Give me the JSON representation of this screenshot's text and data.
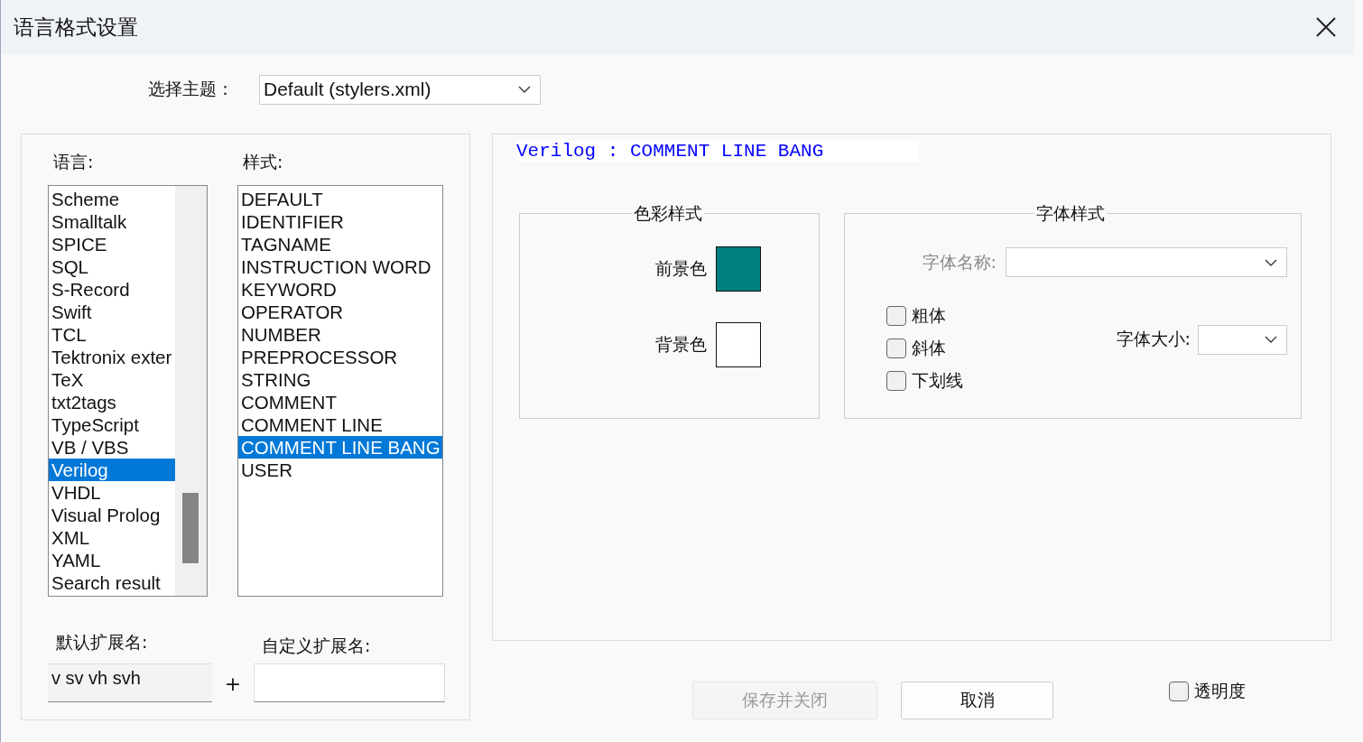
{
  "window": {
    "title": "语言格式设置"
  },
  "theme": {
    "label": "选择主题：",
    "value": "Default (stylers.xml)"
  },
  "languages": {
    "label": "语言:",
    "items": [
      {
        "label": "Scheme",
        "selected": false
      },
      {
        "label": "Smalltalk",
        "selected": false
      },
      {
        "label": "SPICE",
        "selected": false
      },
      {
        "label": "SQL",
        "selected": false
      },
      {
        "label": "S-Record",
        "selected": false
      },
      {
        "label": "Swift",
        "selected": false
      },
      {
        "label": "TCL",
        "selected": false
      },
      {
        "label": "Tektronix exter",
        "selected": false
      },
      {
        "label": "TeX",
        "selected": false
      },
      {
        "label": "txt2tags",
        "selected": false
      },
      {
        "label": "TypeScript",
        "selected": false
      },
      {
        "label": "VB / VBS",
        "selected": false
      },
      {
        "label": "Verilog",
        "selected": true
      },
      {
        "label": "VHDL",
        "selected": false
      },
      {
        "label": "Visual Prolog",
        "selected": false
      },
      {
        "label": "XML",
        "selected": false
      },
      {
        "label": "YAML",
        "selected": false
      },
      {
        "label": "Search result",
        "selected": false
      }
    ]
  },
  "styles": {
    "label": "样式:",
    "items": [
      {
        "label": "DEFAULT",
        "selected": false
      },
      {
        "label": "IDENTIFIER",
        "selected": false
      },
      {
        "label": "TAGNAME",
        "selected": false
      },
      {
        "label": "INSTRUCTION WORD",
        "selected": false
      },
      {
        "label": "KEYWORD",
        "selected": false
      },
      {
        "label": "OPERATOR",
        "selected": false
      },
      {
        "label": "NUMBER",
        "selected": false
      },
      {
        "label": "PREPROCESSOR",
        "selected": false
      },
      {
        "label": "STRING",
        "selected": false
      },
      {
        "label": "COMMENT",
        "selected": false
      },
      {
        "label": "COMMENT LINE",
        "selected": false
      },
      {
        "label": "COMMENT LINE BANG",
        "selected": true
      },
      {
        "label": "USER",
        "selected": false
      }
    ]
  },
  "default_ext": {
    "label": "默认扩展名:",
    "value": "v sv vh svh"
  },
  "plus": "+",
  "custom_ext": {
    "label": "自定义扩展名:"
  },
  "preview": {
    "text": "Verilog : COMMENT LINE BANG"
  },
  "color_style": {
    "title": "色彩样式",
    "foreground": {
      "label": "前景色",
      "color": "#008080"
    },
    "background": {
      "label": "背景色",
      "color": "#ffffff"
    }
  },
  "font_style": {
    "title": "字体样式",
    "font_name": {
      "label": "字体名称:",
      "disabled": true
    },
    "font_size": {
      "label": "字体大小:"
    },
    "checkboxes": [
      {
        "label": "粗体",
        "checked": false
      },
      {
        "label": "斜体",
        "checked": false
      },
      {
        "label": "下划线",
        "checked": false
      }
    ]
  },
  "buttons": [
    {
      "label": "保存并关闭",
      "disabled": true
    },
    {
      "label": "取消",
      "disabled": false
    }
  ],
  "transparency": {
    "label": "透明度",
    "checked": false
  }
}
